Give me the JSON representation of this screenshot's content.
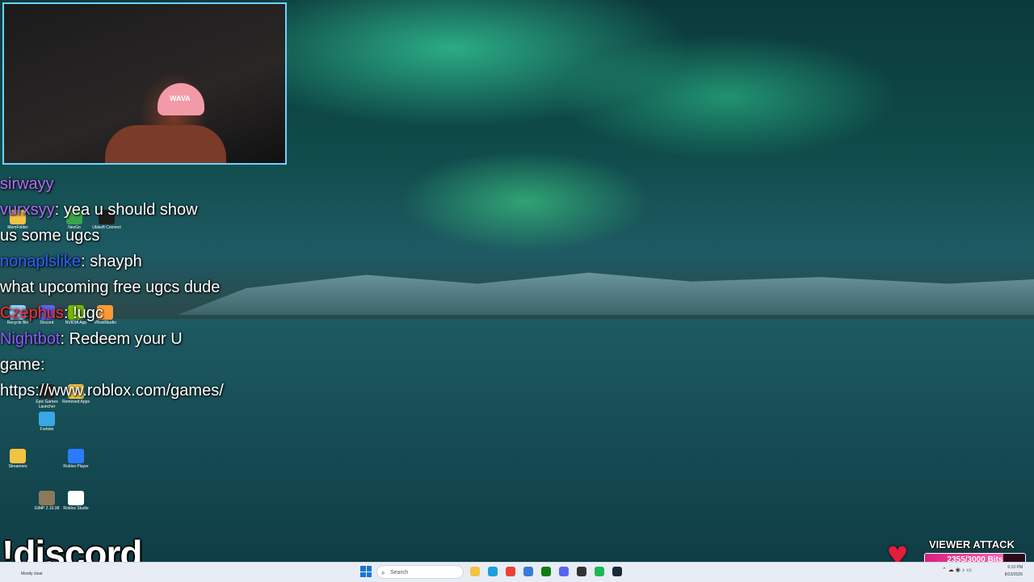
{
  "webcam": {
    "cap_text": "WAVA"
  },
  "chat": [
    {
      "name": "sirwayy",
      "name_color": "nm-purple",
      "message": ""
    },
    {
      "name": "vurxsyy",
      "name_color": "nm-purple",
      "message": "yea u should show"
    },
    {
      "name": "",
      "name_color": "",
      "message": "us some ugcs"
    },
    {
      "name": "nonaplslike",
      "name_color": "nm-blue",
      "message": "shayph"
    },
    {
      "name": "",
      "name_color": "",
      "message": "what upcoming free ugcs dude"
    },
    {
      "name": "Czephus",
      "name_color": "nm-red",
      "message": "!ugc"
    },
    {
      "name": "Nightbot",
      "name_color": "nm-nb",
      "message": "Redeem your U"
    },
    {
      "name": "",
      "name_color": "",
      "message": "game:"
    },
    {
      "name": "",
      "name_color": "",
      "message": "https://www.roblox.com/games/"
    }
  ],
  "desktop_icons": [
    {
      "label": "MomFolder",
      "color": "#f3c443"
    },
    {
      "label": "NexGo",
      "color": "#3aa34a"
    },
    {
      "label": "Ubisoft Connect",
      "color": "#1d1d1d"
    },
    {
      "label": "Recycle Bin",
      "color": "#8fd0ff"
    },
    {
      "label": "Discord",
      "color": "#5865f2"
    },
    {
      "label": "NVIDIA App",
      "color": "#76b900"
    },
    {
      "label": "VRoidStudio",
      "color": "#ff9933"
    },
    {
      "label": "Epic Games Launcher",
      "color": "#2b2b2b"
    },
    {
      "label": "Removed Apps",
      "color": "#f3c443"
    },
    {
      "label": "Fortnite",
      "color": "#39a7e6"
    },
    {
      "label": "Streamers",
      "color": "#f3c443"
    },
    {
      "label": "Roblox Player",
      "color": "#2a7bff"
    },
    {
      "label": "GIMP 2.10.38",
      "color": "#8a7a5a"
    },
    {
      "label": "Roblox Studio",
      "color": "#ffffff"
    }
  ],
  "discord_command": "!discord",
  "viewer_attack": {
    "title": "VIEWER ATTACK",
    "progress_text": "2355/3000 Bits",
    "current": 2355,
    "goal": 3000
  },
  "taskbar": {
    "weather": "Mostly clear",
    "search_placeholder": "Search",
    "apps": [
      {
        "name": "file-explorer",
        "color": "#f3c443"
      },
      {
        "name": "edge",
        "color": "#1aa0e0"
      },
      {
        "name": "chrome",
        "color": "#e94235"
      },
      {
        "name": "store",
        "color": "#3a7bd5"
      },
      {
        "name": "xbox",
        "color": "#107c10"
      },
      {
        "name": "discord",
        "color": "#5865f2"
      },
      {
        "name": "obs",
        "color": "#333333"
      },
      {
        "name": "spotify",
        "color": "#1db954"
      },
      {
        "name": "steam",
        "color": "#1b2838"
      }
    ],
    "time": "6:10 PM",
    "date": "8/23/2025"
  }
}
